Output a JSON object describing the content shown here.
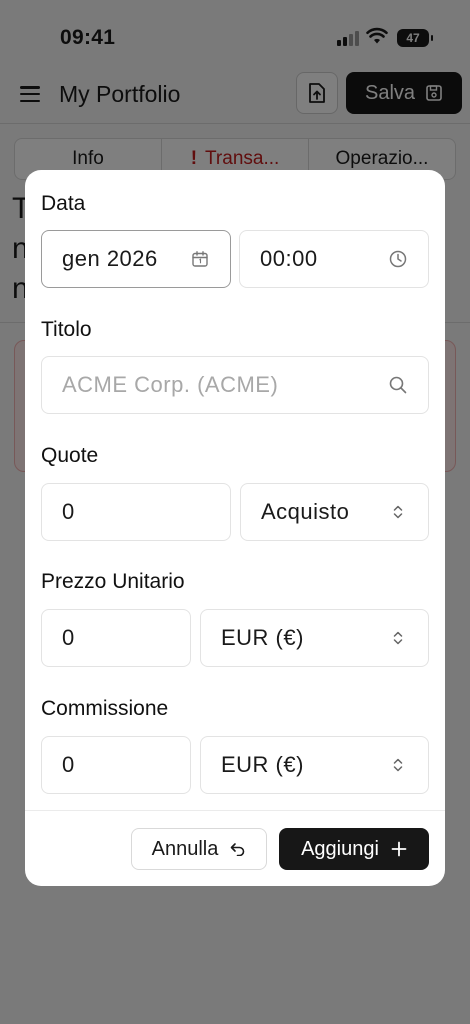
{
  "status_bar": {
    "time": "09:41",
    "battery": "47"
  },
  "app_bar": {
    "title": "My Portfolio",
    "save_label": "Salva"
  },
  "tabs": [
    {
      "label": "Info"
    },
    {
      "label": "Transa...",
      "warning": "!"
    },
    {
      "label": "Operazio..."
    }
  ],
  "background_text": [
    "T",
    "n",
    "n"
  ],
  "form": {
    "date": {
      "label": "Data",
      "month_value": "gen 2026",
      "time_value": "00:00"
    },
    "title": {
      "label": "Titolo",
      "placeholder": "ACME Corp. (ACME)"
    },
    "quantity": {
      "label": "Quote",
      "value": "0",
      "type_value": "Acquisto"
    },
    "unit_price": {
      "label": "Prezzo Unitario",
      "value": "0",
      "currency": "EUR (€)"
    },
    "commission": {
      "label": "Commissione",
      "value": "0",
      "currency": "EUR (€)"
    }
  },
  "footer": {
    "cancel_label": "Annulla",
    "add_label": "Aggiungi"
  },
  "colors": {
    "primary_button": "#171717",
    "warning": "#c21c1c",
    "overlay": "rgba(0,0,0,0.5)"
  }
}
